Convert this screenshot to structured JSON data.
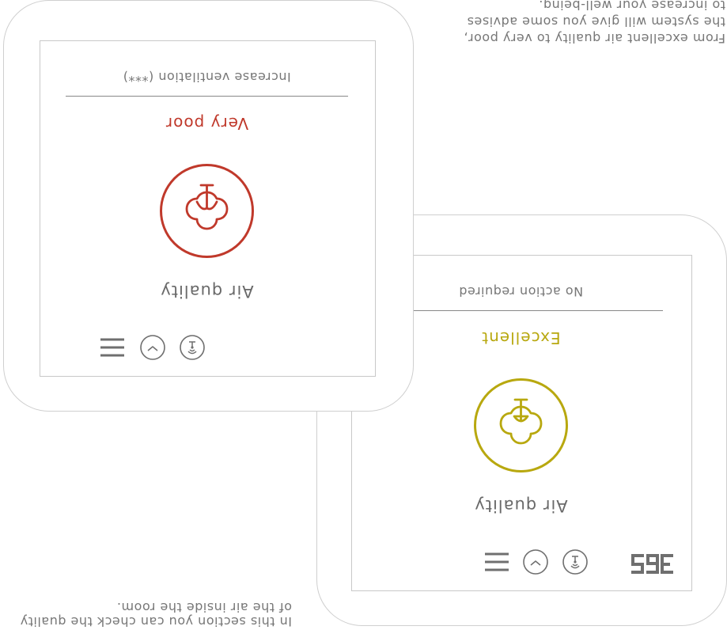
{
  "colors": {
    "excellent": "#b8a80f",
    "very_poor": "#c0392b",
    "ui_gray": "#6f6f6f",
    "text_gray": "#777777"
  },
  "caption_left": {
    "lines": [
      "In this section you can check the quality",
      "of the air inside the room."
    ]
  },
  "caption_right": {
    "lines": [
      "From excellent air quality to very poor,",
      "the system will give you some advises",
      "to increase your well-being."
    ]
  },
  "device_front": {
    "title": "Air quality",
    "status": "Excellent",
    "advice": "No action required",
    "logo": "365",
    "icons": [
      "menu-icon",
      "gauge-icon",
      "signal-icon",
      "air-quality-icon"
    ]
  },
  "device_back": {
    "title": "Air quality",
    "status": "Very poor",
    "advice": "Increase ventilation (***)",
    "icons": [
      "menu-icon",
      "gauge-icon",
      "signal-icon",
      "air-quality-icon"
    ]
  }
}
